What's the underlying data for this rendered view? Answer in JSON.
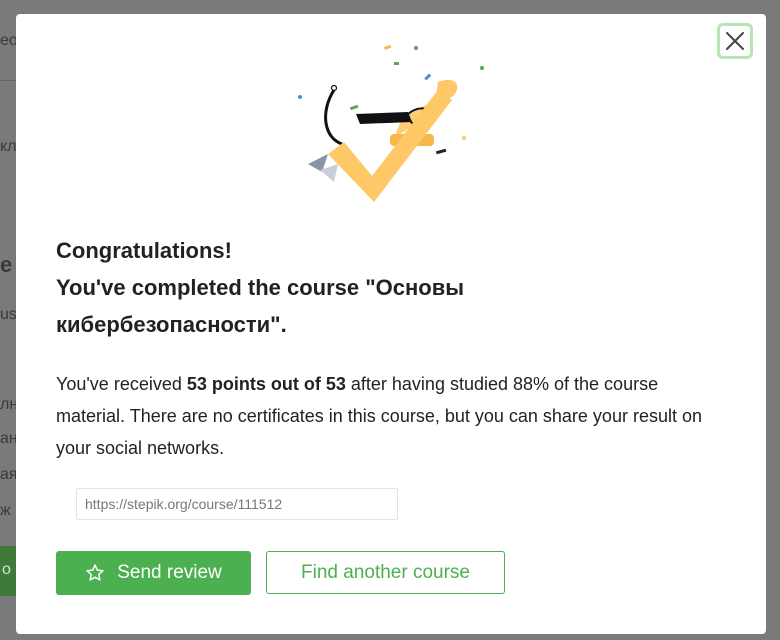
{
  "background": {
    "fragments": [
      "ео",
      "кл",
      "е",
      "us",
      "лн",
      "ан",
      "ая",
      "ж",
      "о"
    ]
  },
  "modal": {
    "close_icon": "close-icon",
    "illustration": "celebration-checkmark-illustration",
    "heading": {
      "line1": "Congratulations!",
      "line2": "You've completed the course \"Основы",
      "line3": "кибербезопасности\"."
    },
    "message": {
      "prefix": "You've received ",
      "points": "53 points out of 53",
      "suffix": " after having studied 88% of the course material. There are no certificates in this course, but you can share your result on your social networks."
    },
    "share_input_value": "https://stepik.org/course/111512",
    "send_review_label": "Send review",
    "send_review_icon": "star-icon",
    "find_course_label": "Find another course"
  },
  "colors": {
    "accent": "#4caf50",
    "close_border": "#b9e4b3",
    "check": "#ffc866"
  }
}
